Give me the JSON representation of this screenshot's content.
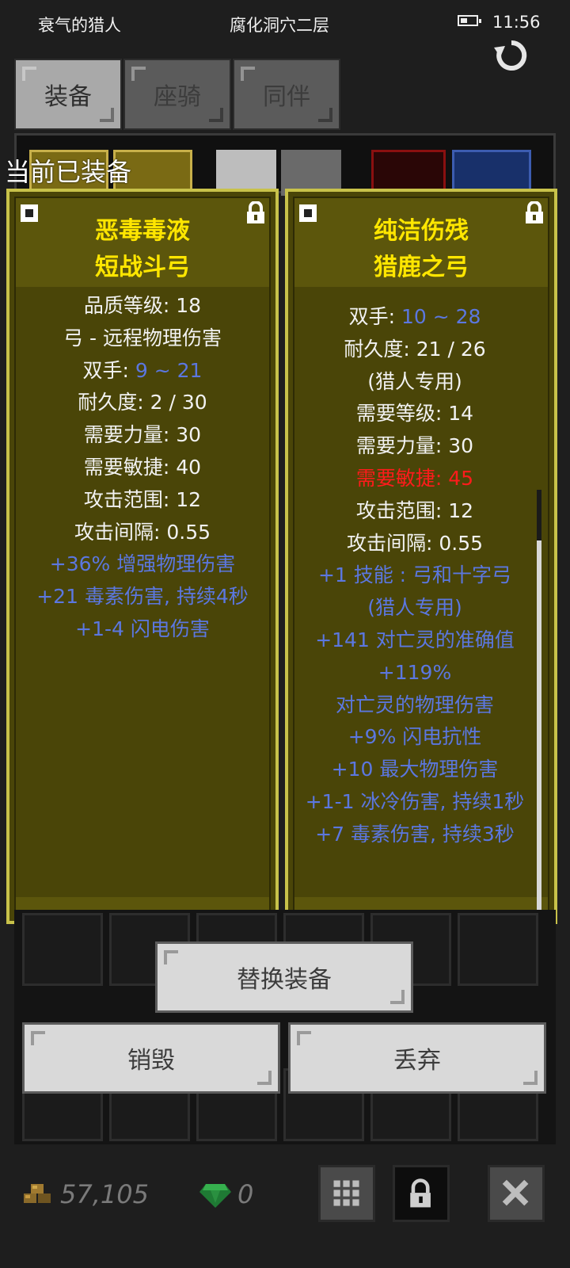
{
  "status_bar": {
    "character": "衰气的猎人",
    "location": "腐化洞穴二层",
    "time": "11:56",
    "battery_icon": "battery-icon",
    "refresh_icon": "refresh-icon"
  },
  "tabs": [
    {
      "label": "装备",
      "active": true
    },
    {
      "label": "座骑",
      "active": false
    },
    {
      "label": "同伴",
      "active": false
    }
  ],
  "equipped_label": "当前已装备",
  "cards": [
    {
      "title_line1": "恶毒毒液",
      "title_line2": "短战斗弓",
      "stats": [
        {
          "text": "品质等级: 18",
          "color": "white"
        },
        {
          "text": "弓 - 远程物理伤害",
          "color": "white"
        },
        {
          "text": "双手: 9 ~ 21",
          "color": "mixed"
        },
        {
          "text": "耐久度: 2 / 30",
          "color": "white"
        },
        {
          "text": "需要力量: 30",
          "color": "white"
        },
        {
          "text": "需要敏捷: 40",
          "color": "white"
        },
        {
          "text": "攻击范围: 12",
          "color": "white"
        },
        {
          "text": "攻击间隔: 0.55",
          "color": "white"
        },
        {
          "text": "+36% 增强物理伤害",
          "color": "blue"
        },
        {
          "text": "+21 毒素伤害, 持续4秒",
          "color": "blue"
        },
        {
          "text": "+1-4 闪电伤害",
          "color": "blue"
        }
      ]
    },
    {
      "title_line1": "纯洁伤残",
      "title_line2": "猎鹿之弓",
      "stats": [
        {
          "text": "双手: 10 ~ 28",
          "color": "mixed"
        },
        {
          "text": "耐久度: 21 / 26",
          "color": "white"
        },
        {
          "text": "(猎人专用)",
          "color": "white"
        },
        {
          "text": "需要等级: 14",
          "color": "white"
        },
        {
          "text": "需要力量: 30",
          "color": "white"
        },
        {
          "text": "需要敏捷: 45",
          "color": "red"
        },
        {
          "text": "攻击范围: 12",
          "color": "white"
        },
        {
          "text": "攻击间隔: 0.55",
          "color": "white"
        },
        {
          "text": "+1 技能 : 弓和十字弓",
          "color": "blue"
        },
        {
          "text": "(猎人专用)",
          "color": "blue"
        },
        {
          "text": "+141 对亡灵的准确值",
          "color": "blue"
        },
        {
          "text": "+119%",
          "color": "blue"
        },
        {
          "text": "对亡灵的物理伤害",
          "color": "blue"
        },
        {
          "text": "+9% 闪电抗性",
          "color": "blue"
        },
        {
          "text": "+10 最大物理伤害",
          "color": "blue"
        },
        {
          "text": "+1-1 冰冷伤害, 持续1秒",
          "color": "blue"
        },
        {
          "text": "+7 毒素伤害, 持续3秒",
          "color": "blue"
        }
      ]
    }
  ],
  "dual_parts": [
    {
      "label": "双手: ",
      "value": "9 ~ 21"
    },
    {
      "label": "双手: ",
      "value": "10 ~ 28"
    }
  ],
  "buttons": {
    "replace": "替换装备",
    "destroy": "销毁",
    "discard": "丢弃"
  },
  "currency": {
    "gold": "57,105",
    "gems": "0"
  },
  "colors": {
    "card_bg": "#4a4508",
    "card_border": "#c8c24a",
    "title": "#ffe600",
    "stat_blue": "#5b77e0",
    "stat_red": "#ff1b1b"
  }
}
